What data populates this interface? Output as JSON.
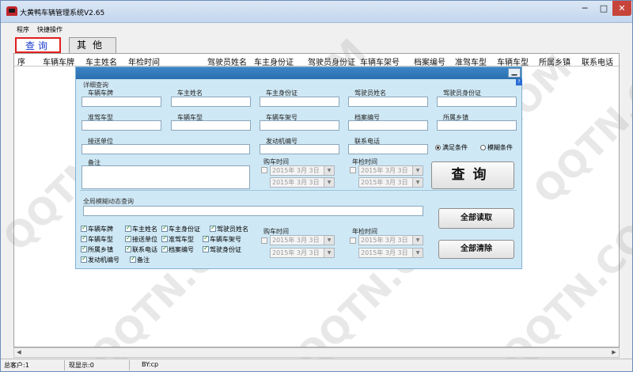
{
  "window": {
    "title": "大黄鸭车辆管理系统V2.65",
    "min_glyph": "─",
    "max_glyph": "□",
    "close_glyph": "✕"
  },
  "menu": [
    "程序",
    "快捷操作"
  ],
  "tabs": {
    "query": "查询",
    "other": "其他"
  },
  "grid": {
    "columns": [
      "序",
      "车辆车牌",
      "车主姓名",
      "年检时间",
      "驾驶员姓名",
      "车主身份证",
      "驾驶员身份证",
      "车辆车架号",
      "档案编号",
      "准驾车型",
      "车辆车型",
      "所属乡镇",
      "联系电话"
    ]
  },
  "scroll": {
    "left_arrow": "◀",
    "right_arrow": "▶"
  },
  "status": {
    "total": "总客户:1",
    "shown": "现显示:0",
    "by": "BY:cp"
  },
  "watermark": "QQTN.COM",
  "dialog": {
    "min_glyph": "▁",
    "help_glyph": "?",
    "detail_title": "详细查询",
    "fields": {
      "plate": "车辆车牌",
      "owner_name": "车主姓名",
      "owner_id": "车主身份证",
      "driver_name": "驾驶员姓名",
      "driver_id": "驾驶员身份证",
      "license_type": "准驾车型",
      "vehicle_type": "车辆车型",
      "vin": "车辆车架号",
      "file_no": "档案编号",
      "township": "所属乡镇",
      "unit": "接送单位",
      "engine_no": "发动机编号",
      "phone": "联系电话",
      "remark": "备注"
    },
    "radio_match": "满足条件",
    "radio_fuzzy": "模糊条件",
    "purchase_label": "购车时间",
    "inspection_label": "年检时间",
    "date_value": "2015年  3月  3日",
    "dropdown_glyph": "▼",
    "query_button": "查询",
    "global_title": "全局模糊动态查询",
    "read_all_button": "全部读取",
    "clear_all_button": "全部清除",
    "checks": [
      {
        "label": "车辆车牌",
        "checked": true
      },
      {
        "label": "车主姓名",
        "checked": true
      },
      {
        "label": "车主身份证",
        "checked": true
      },
      {
        "label": "驾驶员姓名",
        "checked": true
      },
      {
        "label": "车辆车型",
        "checked": true
      },
      {
        "label": "接送单位",
        "checked": true
      },
      {
        "label": "准驾车型",
        "checked": true
      },
      {
        "label": "车辆车架号",
        "checked": true
      },
      {
        "label": "所属乡镇",
        "checked": true
      },
      {
        "label": "联系电话",
        "checked": true
      },
      {
        "label": "档案编号",
        "checked": true
      },
      {
        "label": "驾驶身份证",
        "checked": true
      },
      {
        "label": "发动机编号",
        "checked": true
      },
      {
        "label": "备注",
        "checked": true
      }
    ]
  }
}
